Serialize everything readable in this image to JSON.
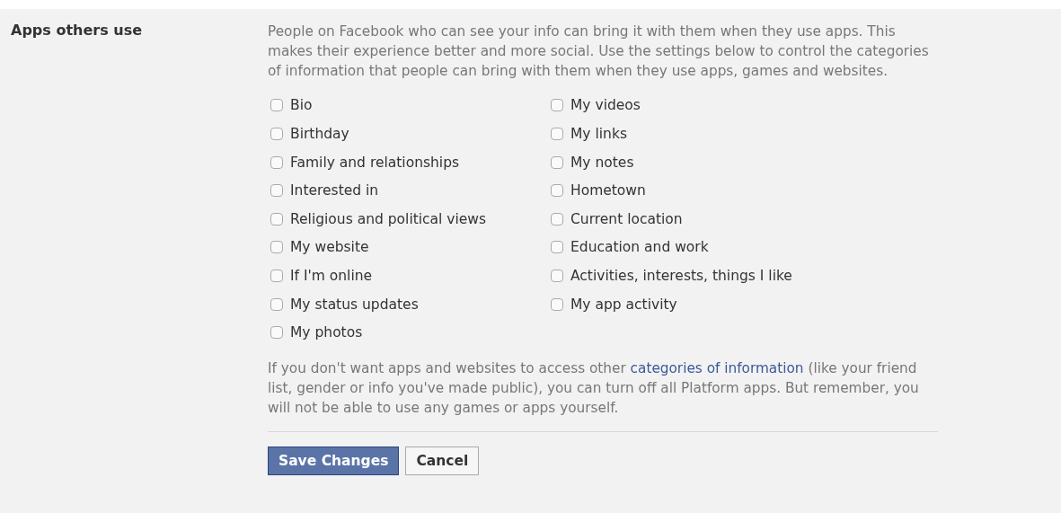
{
  "section": {
    "label": "Apps others use",
    "description": "People on Facebook who can see your info can bring it with them when they use apps. This makes their experience better and more social. Use the settings below to control the categories of information that people can bring with them when they use apps, games and websites.",
    "columns": [
      [
        {
          "label": "Bio",
          "checked": false
        },
        {
          "label": "Birthday",
          "checked": false
        },
        {
          "label": "Family and relationships",
          "checked": false
        },
        {
          "label": "Interested in",
          "checked": false
        },
        {
          "label": "Religious and political views",
          "checked": false
        },
        {
          "label": "My website",
          "checked": false
        },
        {
          "label": "If I'm online",
          "checked": false
        },
        {
          "label": "My status updates",
          "checked": false
        },
        {
          "label": "My photos",
          "checked": false
        }
      ],
      [
        {
          "label": "My videos",
          "checked": false
        },
        {
          "label": "My links",
          "checked": false
        },
        {
          "label": "My notes",
          "checked": false
        },
        {
          "label": "Hometown",
          "checked": false
        },
        {
          "label": "Current location",
          "checked": false
        },
        {
          "label": "Education and work",
          "checked": false
        },
        {
          "label": "Activities, interests, things I like",
          "checked": false
        },
        {
          "label": "My app activity",
          "checked": false
        }
      ]
    ],
    "note": {
      "before": "If you don't want apps and websites to access other ",
      "link": "categories of information",
      "after": " (like your friend list, gender or info you've made public), you can turn off all Platform apps. But remember, you will not be able to use any games or apps yourself."
    },
    "buttons": [
      {
        "label": "Save Changes",
        "kind": "primary"
      },
      {
        "label": "Cancel",
        "kind": "secondary"
      }
    ]
  }
}
